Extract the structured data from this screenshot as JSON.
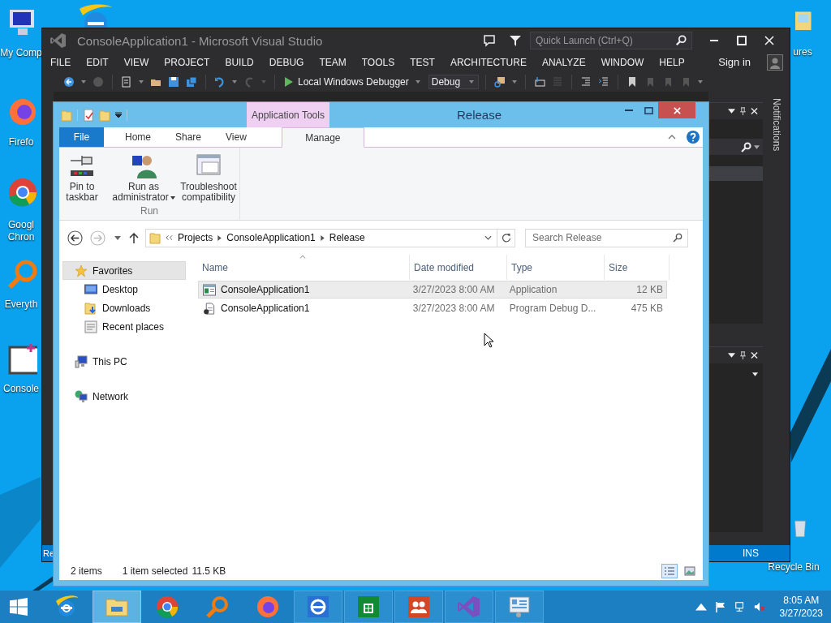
{
  "desktop": {
    "icons_left": [
      {
        "label": "My Comp",
        "kind": "computer"
      },
      {
        "label": "Firefo",
        "kind": "firefox"
      },
      {
        "label": "Googl Chron",
        "kind": "chrome"
      },
      {
        "label": "Everyth",
        "kind": "everything"
      },
      {
        "label": "Console",
        "kind": "project"
      }
    ],
    "icons_right": [
      {
        "label": "ures",
        "kind": "pictures"
      },
      {
        "label": "Recycle Bin",
        "kind": "recycle"
      }
    ]
  },
  "visual_studio": {
    "title": "ConsoleApplication1 - Microsoft Visual Studio",
    "quick_launch": {
      "placeholder": "Quick Launch (Ctrl+Q)"
    },
    "menu": [
      "FILE",
      "EDIT",
      "VIEW",
      "PROJECT",
      "BUILD",
      "DEBUG",
      "TEAM",
      "TOOLS",
      "TEST",
      "ARCHITECTURE",
      "ANALYZE",
      "WINDOW",
      "HELP"
    ],
    "sign_in": "Sign in",
    "toolbar": {
      "debugger": "Local Windows Debugger",
      "configuration": "Debug"
    },
    "side_tab": "Notifications",
    "status_bar": {
      "left": "Re",
      "right": "INS"
    }
  },
  "explorer": {
    "title": "Release",
    "contextual_tab": "Application Tools",
    "tabs": [
      {
        "label": "File",
        "kind": "file",
        "selected": false
      },
      {
        "label": "Home",
        "kind": "tab",
        "selected": false
      },
      {
        "label": "Share",
        "kind": "tab",
        "selected": false
      },
      {
        "label": "View",
        "kind": "tab",
        "selected": false
      },
      {
        "label": "Manage",
        "kind": "contextual",
        "selected": true
      }
    ],
    "ribbon": {
      "commands": [
        {
          "label": "Pin to taskbar",
          "kind": "pin",
          "dropdown": false
        },
        {
          "label": "Run as administrator",
          "kind": "runas",
          "dropdown": true
        },
        {
          "label": "Troubleshoot compatibility",
          "kind": "troubleshoot",
          "dropdown": false
        }
      ],
      "group": "Run"
    },
    "breadcrumb": [
      "Projects",
      "ConsoleApplication1",
      "Release"
    ],
    "search": {
      "placeholder": "Search Release"
    },
    "nav": [
      {
        "label": "Favorites",
        "kind": "favorites",
        "selected": true,
        "children": [
          {
            "label": "Desktop",
            "kind": "desktop",
            "selected": false
          },
          {
            "label": "Downloads",
            "kind": "downloads",
            "selected": false
          },
          {
            "label": "Recent places",
            "kind": "recent",
            "selected": false
          }
        ]
      },
      {
        "label": "This PC",
        "kind": "pc",
        "selected": false
      },
      {
        "label": "Network",
        "kind": "network",
        "selected": false
      }
    ],
    "columns": [
      "Name",
      "Date modified",
      "Type",
      "Size"
    ],
    "rows": [
      {
        "name": "ConsoleApplication1",
        "date": "3/27/2023 8:00 AM",
        "type": "Application",
        "size": "12 KB",
        "kind": "exe",
        "selected": true
      },
      {
        "name": "ConsoleApplication1",
        "date": "3/27/2023 8:00 AM",
        "type": "Program Debug D...",
        "size": "475 KB",
        "kind": "pdb",
        "selected": false
      }
    ],
    "status": {
      "count": "2 items",
      "selection": "1 item selected",
      "size": "11.5 KB"
    },
    "views": [
      {
        "kind": "details",
        "selected": true
      },
      {
        "kind": "tiles",
        "selected": false
      }
    ]
  },
  "taskbar": {
    "apps": [
      {
        "kind": "ie",
        "selected": false,
        "running": false
      },
      {
        "kind": "explorer",
        "selected": true,
        "running": true
      },
      {
        "kind": "chrome",
        "selected": false,
        "running": false
      },
      {
        "kind": "everything",
        "selected": false,
        "running": false
      },
      {
        "kind": "firefox",
        "selected": false,
        "running": false
      },
      {
        "kind": "ie-metro",
        "selected": false,
        "running": true
      },
      {
        "kind": "store",
        "selected": false,
        "running": true
      },
      {
        "kind": "people",
        "selected": false,
        "running": true
      },
      {
        "kind": "vs",
        "selected": false,
        "running": true
      },
      {
        "kind": "control",
        "selected": false,
        "running": true
      }
    ],
    "clock": {
      "time": "8:05 AM",
      "date": "3/27/2023"
    }
  }
}
